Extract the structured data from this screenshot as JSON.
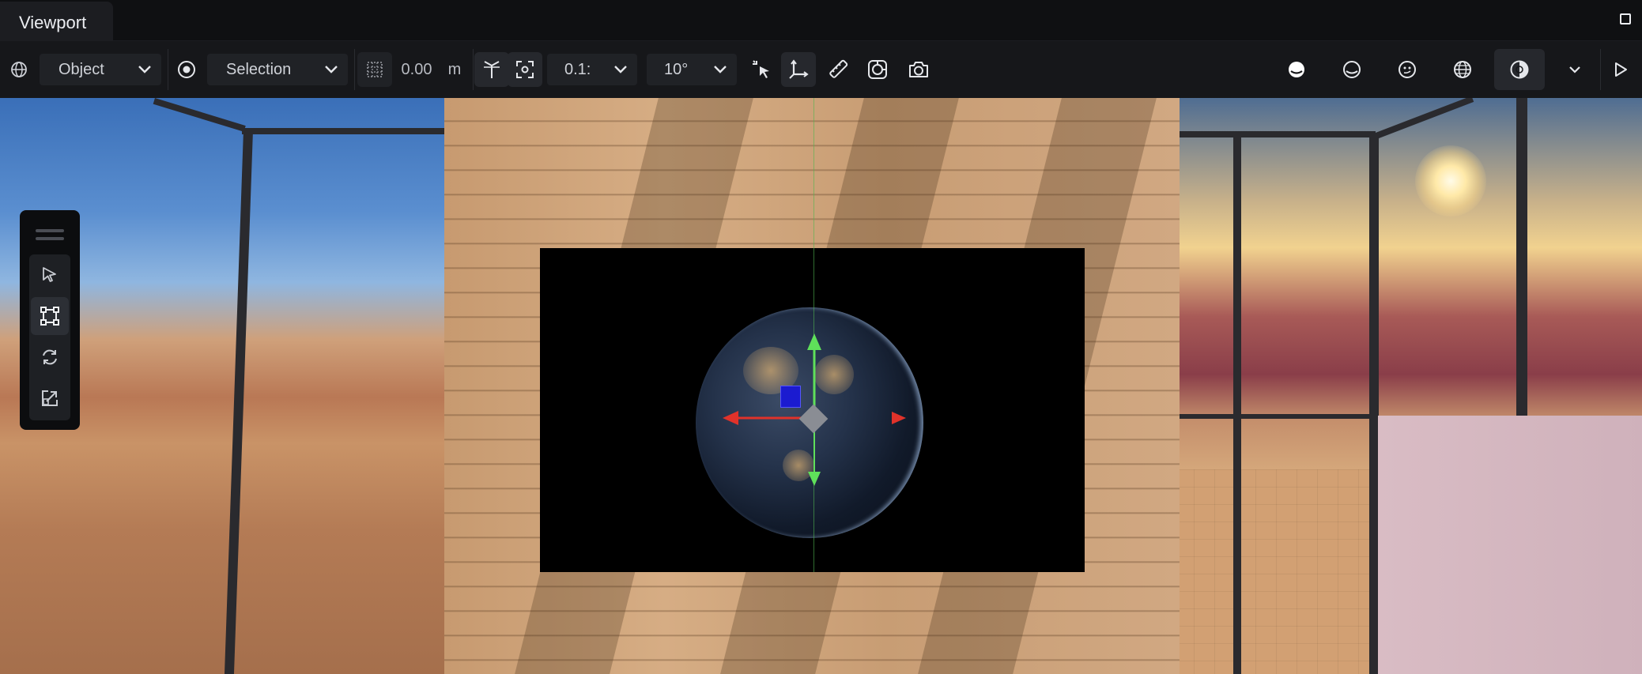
{
  "tab": {
    "title": "Viewport"
  },
  "toolbar": {
    "space_mode": "Object",
    "pivot_mode": "Selection",
    "grid_snap_value": "0.00",
    "grid_snap_unit": "m",
    "move_snap_value": "0.1:",
    "rotation_snap_value": "10°"
  },
  "icons": {
    "world": "globe-icon",
    "pivot": "target-icon",
    "grid": "grid-icon",
    "origin": "origin-icon",
    "focus": "focus-frame-icon",
    "select_cursor": "cursor-sparkle-icon",
    "axes": "axes-icon",
    "ruler": "ruler-icon",
    "screenshot_object": "object-capture-icon",
    "camera": "camera-icon",
    "shade_solid": "shading-solid-icon",
    "shade_outline": "shading-outline-icon",
    "shade_face": "shading-face-icon",
    "wireframe": "wireframe-globe-icon",
    "lighting": "lighting-contrast-icon",
    "more": "chevron-down-icon",
    "play": "play-icon"
  },
  "toolbox": {
    "tools": [
      "select",
      "transform",
      "rotate",
      "scale"
    ]
  },
  "colors": {
    "accent_active": "#2c2f35",
    "gizmo_x": "#e0322a",
    "gizmo_y": "#5fe05a",
    "gizmo_center": "#8a8d94"
  }
}
